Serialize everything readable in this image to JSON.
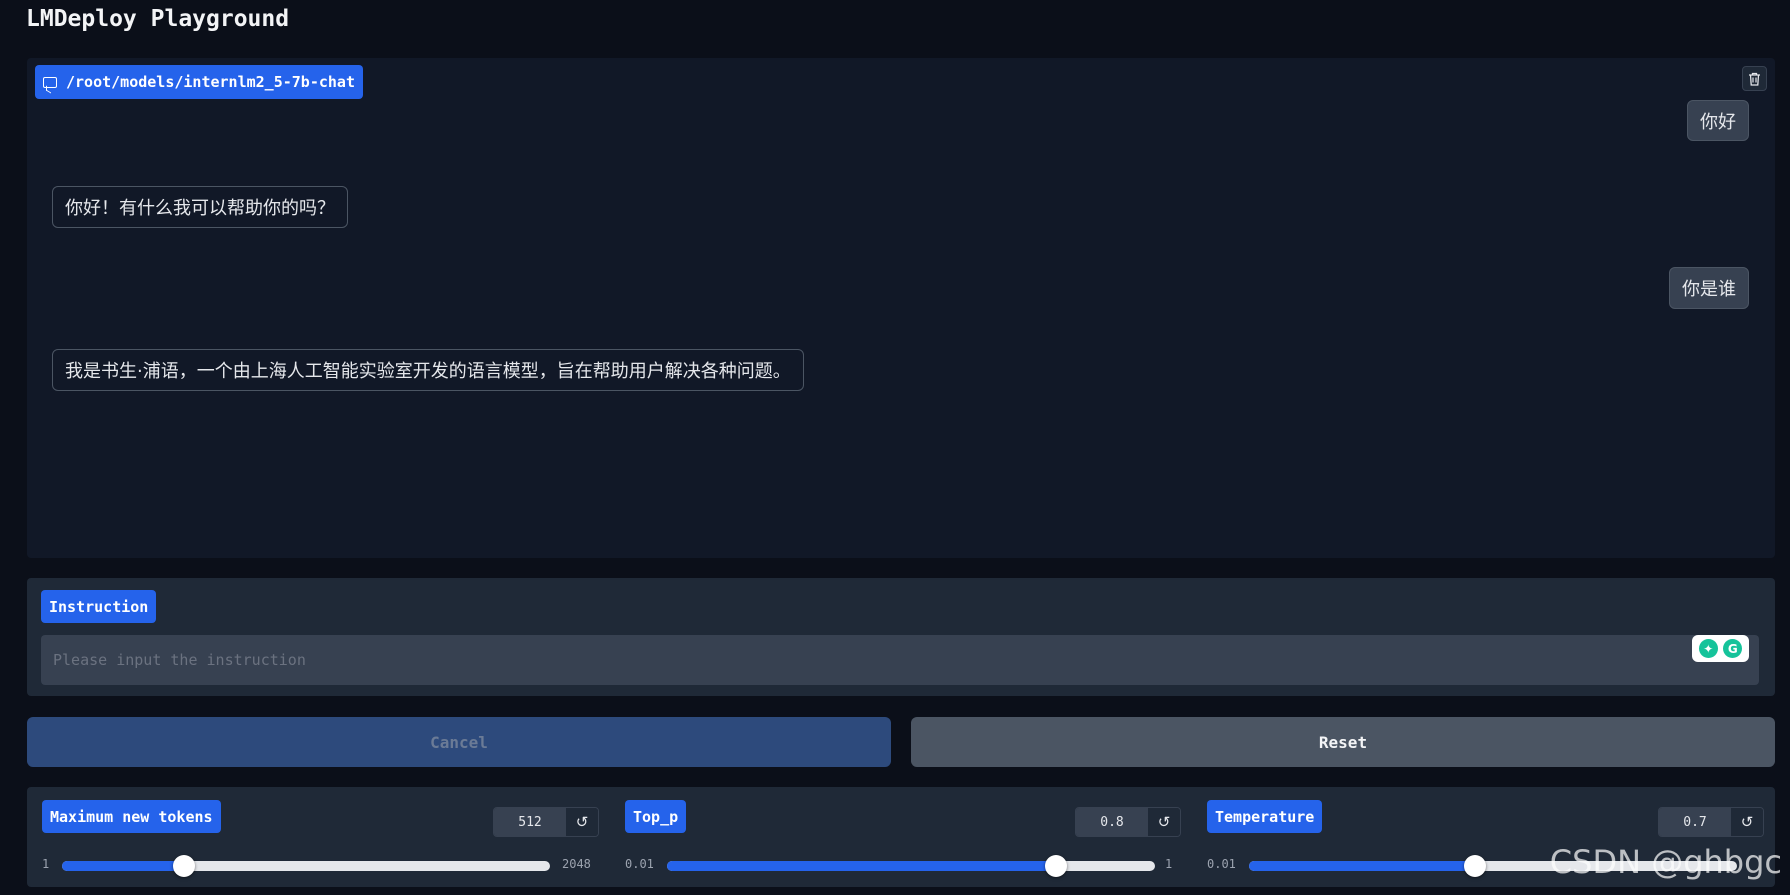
{
  "app": {
    "title": "LMDeploy Playground"
  },
  "chatbot": {
    "model_label": "/root/models/internlm2_5-7b-chat",
    "clear_icon": "trash-icon",
    "messages": [
      {
        "role": "user",
        "text": "你好"
      },
      {
        "role": "assistant",
        "text": "你好！有什么我可以帮助你的吗？"
      },
      {
        "role": "user",
        "text": "你是谁"
      },
      {
        "role": "assistant",
        "text": "我是书生·浦语，一个由上海人工智能实验室开发的语言模型，旨在帮助用户解决各种问题。"
      }
    ]
  },
  "instruction": {
    "label": "Instruction",
    "placeholder": "Please input the instruction",
    "value": ""
  },
  "buttons": {
    "cancel": "Cancel",
    "reset": "Reset"
  },
  "sliders": [
    {
      "label": "Maximum new tokens",
      "value": "512",
      "min": "1",
      "max": "2048",
      "fraction": 0.25
    },
    {
      "label": "Top_p",
      "value": "0.8",
      "min": "0.01",
      "max": "1",
      "fraction": 0.798
    },
    {
      "label": "Temperature",
      "value": "0.7",
      "min": "0.01",
      "max": "1.5",
      "fraction": 0.463
    }
  ],
  "reset_icon": "reset-icon",
  "watermark": "CSDN @ghbgc",
  "colors": {
    "accent": "#2563eb",
    "background": "#0b0f19",
    "panel": "#1f2937"
  }
}
